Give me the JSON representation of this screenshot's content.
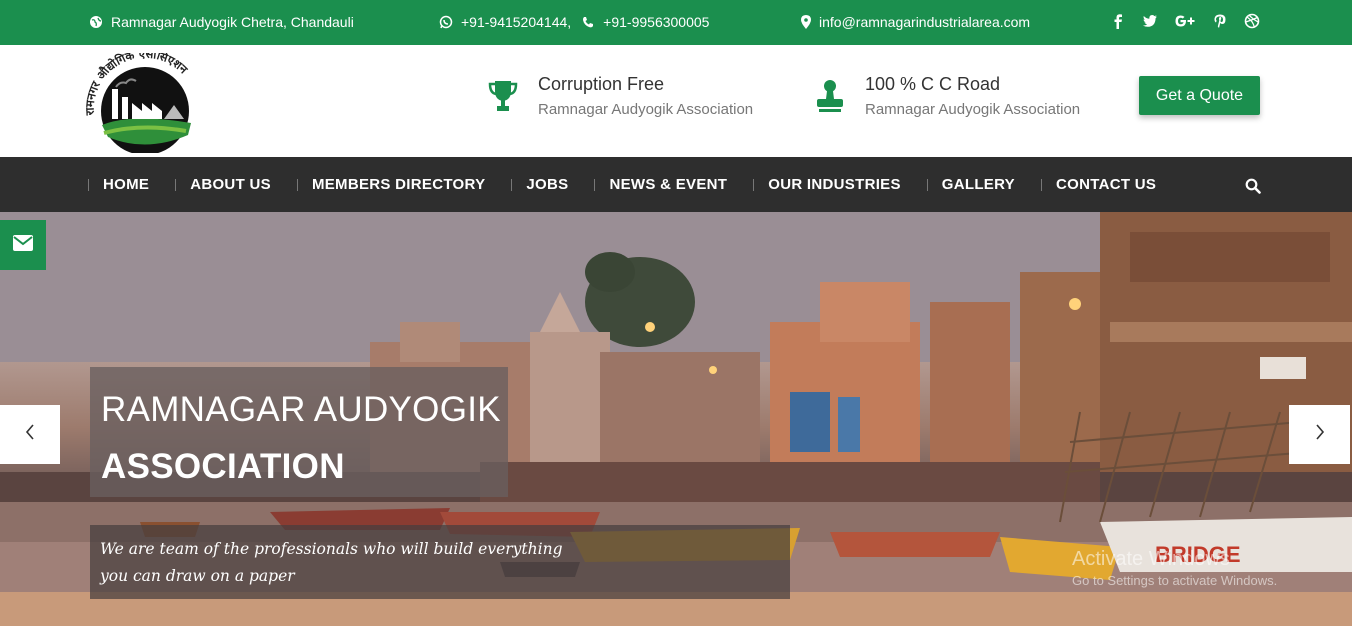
{
  "topbar": {
    "address": "Ramnagar Audyogik Chetra, Chandauli",
    "phone1": "+91-9415204144,",
    "phone2": "+91-9956300005",
    "email": "info@ramnagarindustrialarea.com",
    "social_icons": [
      "facebook-icon",
      "twitter-icon",
      "google-plus-icon",
      "pinterest-icon",
      "dribbble-icon"
    ]
  },
  "header": {
    "logo_text": "रामनगर औद्योगिक एसोसिएशन",
    "features": [
      {
        "icon": "trophy-icon",
        "title": "Corruption Free",
        "subtitle": "Ramnagar Audyogik Association"
      },
      {
        "icon": "stamp-icon",
        "title": "100 % C C Road",
        "subtitle": "Ramnagar Audyogik Association"
      }
    ],
    "quote_button": "Get a Quote"
  },
  "nav": {
    "items": [
      "HOME",
      "ABOUT US",
      "MEMBERS DIRECTORY",
      "JOBS",
      "NEWS & EVENT",
      "OUR INDUSTRIES",
      "GALLERY",
      "CONTACT US"
    ]
  },
  "hero": {
    "title_line1": "RAMNAGAR AUDYOGIK",
    "title_line2": "ASSOCIATION",
    "tagline_line1": "We are team of the professionals who will build everything",
    "tagline_line2": "you can draw on a paper"
  },
  "watermark": {
    "line1": "Activate Windows",
    "line2": "Go to Settings to activate Windows."
  },
  "colors": {
    "brand_green": "#1b8f4e",
    "nav_bg": "#2e2e2e"
  }
}
